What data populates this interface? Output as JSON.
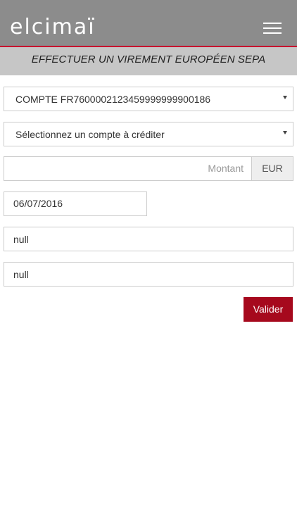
{
  "header": {
    "logo_text": "elcimaï",
    "menu_icon": "hamburger-menu-icon"
  },
  "page": {
    "title": "EFFECTUER UN VIREMENT EUROPÉEN SEPA"
  },
  "form": {
    "debit_account": {
      "value": "COMPTE FR7600002123459999999900186",
      "icon": "caret-down-icon"
    },
    "credit_account": {
      "value": "Sélectionnez un compte à créditer",
      "icon": "caret-down-icon"
    },
    "amount": {
      "placeholder": "Montant",
      "currency": "EUR"
    },
    "date": {
      "value": "06/07/2016"
    },
    "field_1": {
      "value": "null"
    },
    "field_2": {
      "value": "null"
    },
    "submit_label": "Valider"
  },
  "colors": {
    "header_bg": "#8c8c8c",
    "accent_red": "#c8102e",
    "button_bg": "#a6091d",
    "subheader_bg": "#c6c6c6"
  }
}
